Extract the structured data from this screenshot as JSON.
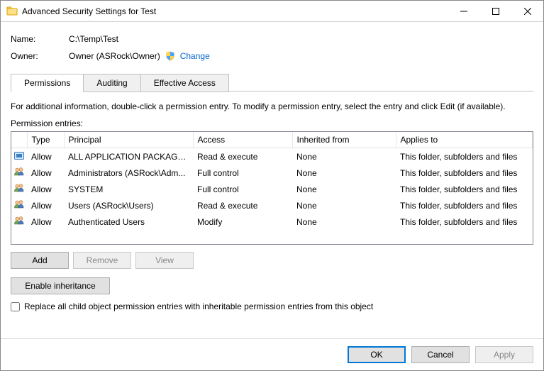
{
  "titlebar": {
    "title": "Advanced Security Settings for Test"
  },
  "labels": {
    "name": "Name:",
    "owner": "Owner:",
    "change": "Change",
    "permission_entries": "Permission entries:"
  },
  "values": {
    "path": "C:\\Temp\\Test",
    "owner": "Owner (ASRock\\Owner)"
  },
  "info_text": "For additional information, double-click a permission entry. To modify a permission entry, select the entry and click Edit (if available).",
  "tabs": [
    {
      "label": "Permissions",
      "active": true
    },
    {
      "label": "Auditing",
      "active": false
    },
    {
      "label": "Effective Access",
      "active": false
    }
  ],
  "columns": {
    "type": "Type",
    "principal": "Principal",
    "access": "Access",
    "inherited": "Inherited from",
    "applies": "Applies to"
  },
  "entries": [
    {
      "icon": "package",
      "type": "Allow",
      "principal": "ALL APPLICATION PACKAGES",
      "access": "Read & execute",
      "inherited": "None",
      "applies": "This folder, subfolders and files"
    },
    {
      "icon": "group",
      "type": "Allow",
      "principal": "Administrators (ASRock\\Adm...",
      "access": "Full control",
      "inherited": "None",
      "applies": "This folder, subfolders and files"
    },
    {
      "icon": "group",
      "type": "Allow",
      "principal": "SYSTEM",
      "access": "Full control",
      "inherited": "None",
      "applies": "This folder, subfolders and files"
    },
    {
      "icon": "group",
      "type": "Allow",
      "principal": "Users (ASRock\\Users)",
      "access": "Read & execute",
      "inherited": "None",
      "applies": "This folder, subfolders and files"
    },
    {
      "icon": "group",
      "type": "Allow",
      "principal": "Authenticated Users",
      "access": "Modify",
      "inherited": "None",
      "applies": "This folder, subfolders and files"
    }
  ],
  "buttons": {
    "add": "Add",
    "remove": "Remove",
    "view": "View",
    "enable_inheritance": "Enable inheritance",
    "ok": "OK",
    "cancel": "Cancel",
    "apply": "Apply"
  },
  "checkbox": {
    "replace_label": "Replace all child object permission entries with inheritable permission entries from this object",
    "checked": false
  }
}
